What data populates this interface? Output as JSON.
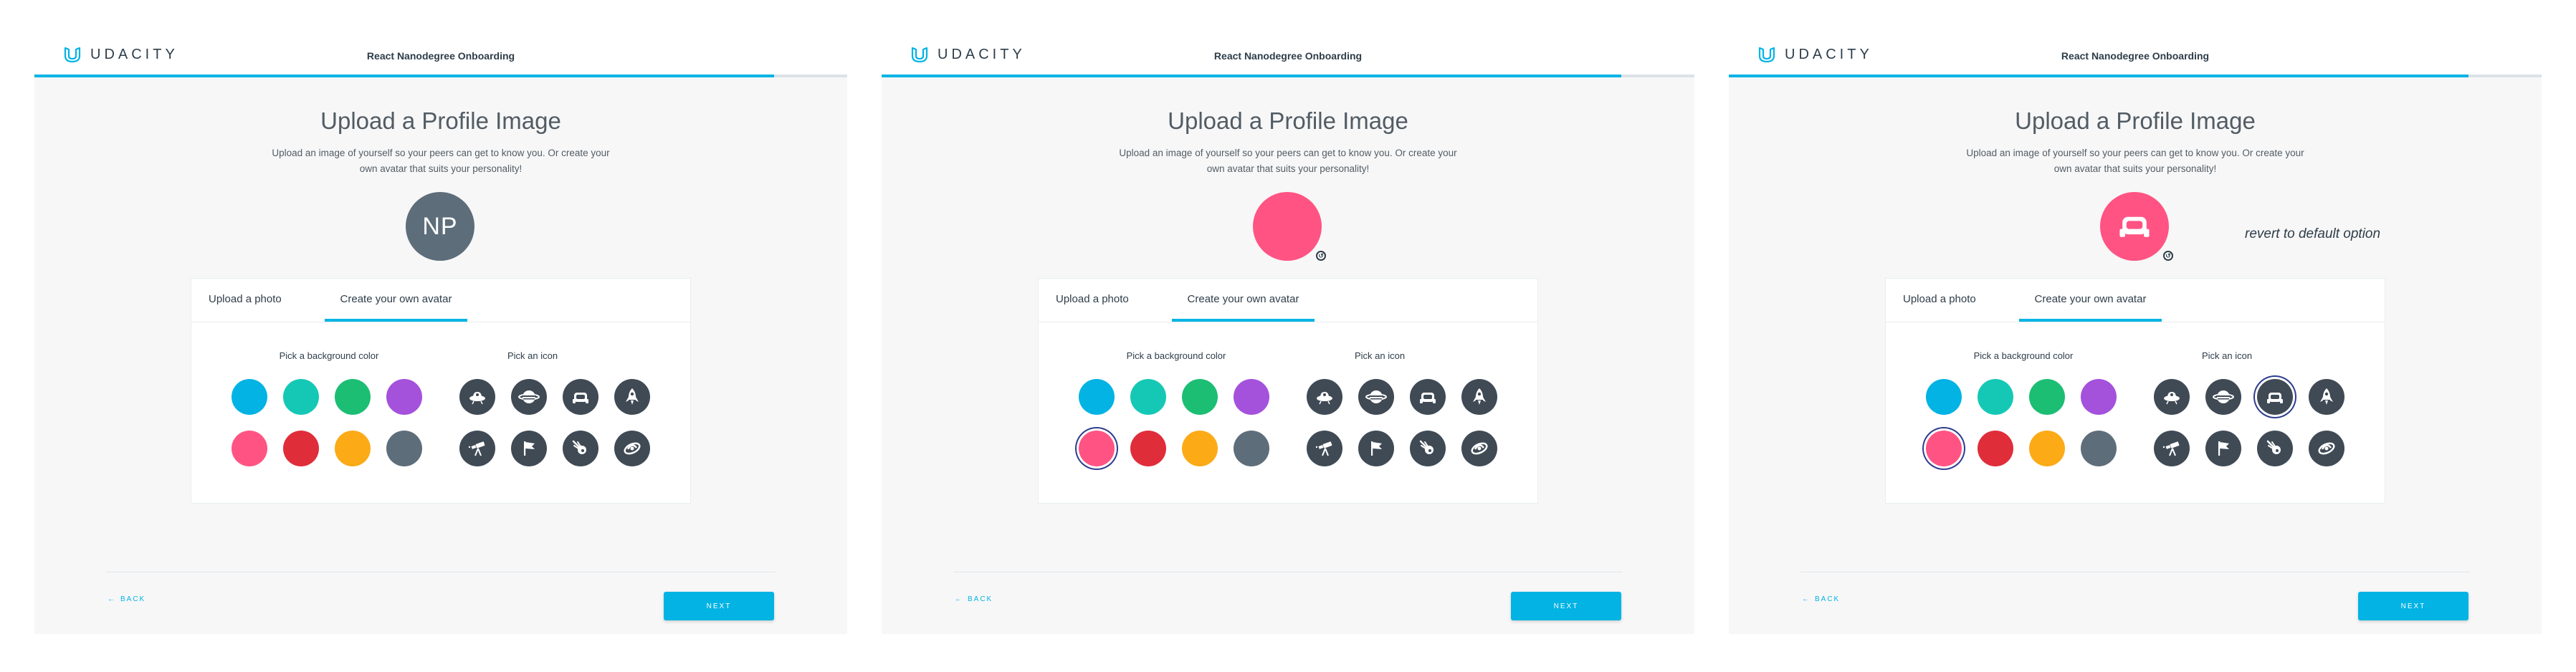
{
  "brand": {
    "name": "UDACITY",
    "color": "#02b3e4",
    "logo_icon": "udacity-u-logo"
  },
  "progress_percent": 91,
  "screens": [
    {
      "header_title": "React Nanodegree Onboarding",
      "page_title": "Upload a Profile Image",
      "subtitle": "Upload an image of yourself so your peers can get to know you. Or create your own avatar that suits your personality!",
      "avatar": {
        "type": "initials",
        "initials": "NP",
        "background": "#5e6d7a",
        "icon": ""
      },
      "revert_note": "",
      "tabs": [
        {
          "label": "Upload a photo",
          "active": false
        },
        {
          "label": "Create your own avatar",
          "active": true
        }
      ],
      "colors_label": "Pick a background color",
      "icons_label": "Pick an icon",
      "selected_color": -1,
      "selected_icon": -1,
      "back_label": "BACK",
      "next_label": "NEXT"
    },
    {
      "header_title": "React Nanodegree Onboarding",
      "page_title": "Upload a Profile Image",
      "subtitle": "Upload an image of yourself so your peers can get to know you. Or create your own avatar that suits your personality!",
      "avatar": {
        "type": "color",
        "initials": "",
        "background": "#ff5483",
        "icon": ""
      },
      "revert_note": "",
      "tabs": [
        {
          "label": "Upload a photo",
          "active": false
        },
        {
          "label": "Create your own avatar",
          "active": true
        }
      ],
      "colors_label": "Pick a background color",
      "icons_label": "Pick an icon",
      "selected_color": 4,
      "selected_icon": -1,
      "back_label": "BACK",
      "next_label": "NEXT"
    },
    {
      "header_title": "React Nanodegree Onboarding",
      "page_title": "Upload a Profile Image",
      "subtitle": "Upload an image of yourself so your peers can get to know you. Or create your own avatar that suits your personality!",
      "avatar": {
        "type": "icon",
        "initials": "",
        "background": "#ff5483",
        "icon": "rover-icon"
      },
      "revert_note": "revert to default option",
      "tabs": [
        {
          "label": "Upload a photo",
          "active": false
        },
        {
          "label": "Create your own avatar",
          "active": true
        }
      ],
      "colors_label": "Pick a background color",
      "icons_label": "Pick an icon",
      "selected_color": 4,
      "selected_icon": 2,
      "back_label": "BACK",
      "next_label": "NEXT"
    }
  ],
  "color_swatches": [
    {
      "name": "blue",
      "hex": "#02b3e4"
    },
    {
      "name": "teal",
      "hex": "#15c8b5"
    },
    {
      "name": "green",
      "hex": "#1cbe74"
    },
    {
      "name": "purple",
      "hex": "#a451dc"
    },
    {
      "name": "pink",
      "hex": "#ff5483"
    },
    {
      "name": "red",
      "hex": "#e02d3a"
    },
    {
      "name": "orange",
      "hex": "#fcaa16"
    },
    {
      "name": "slate",
      "hex": "#5e6d7a"
    }
  ],
  "avatar_icons": [
    "ufo-icon",
    "planet-icon",
    "rover-icon",
    "rocket-icon",
    "telescope-icon",
    "flag-icon",
    "comet-icon",
    "galaxy-icon"
  ]
}
